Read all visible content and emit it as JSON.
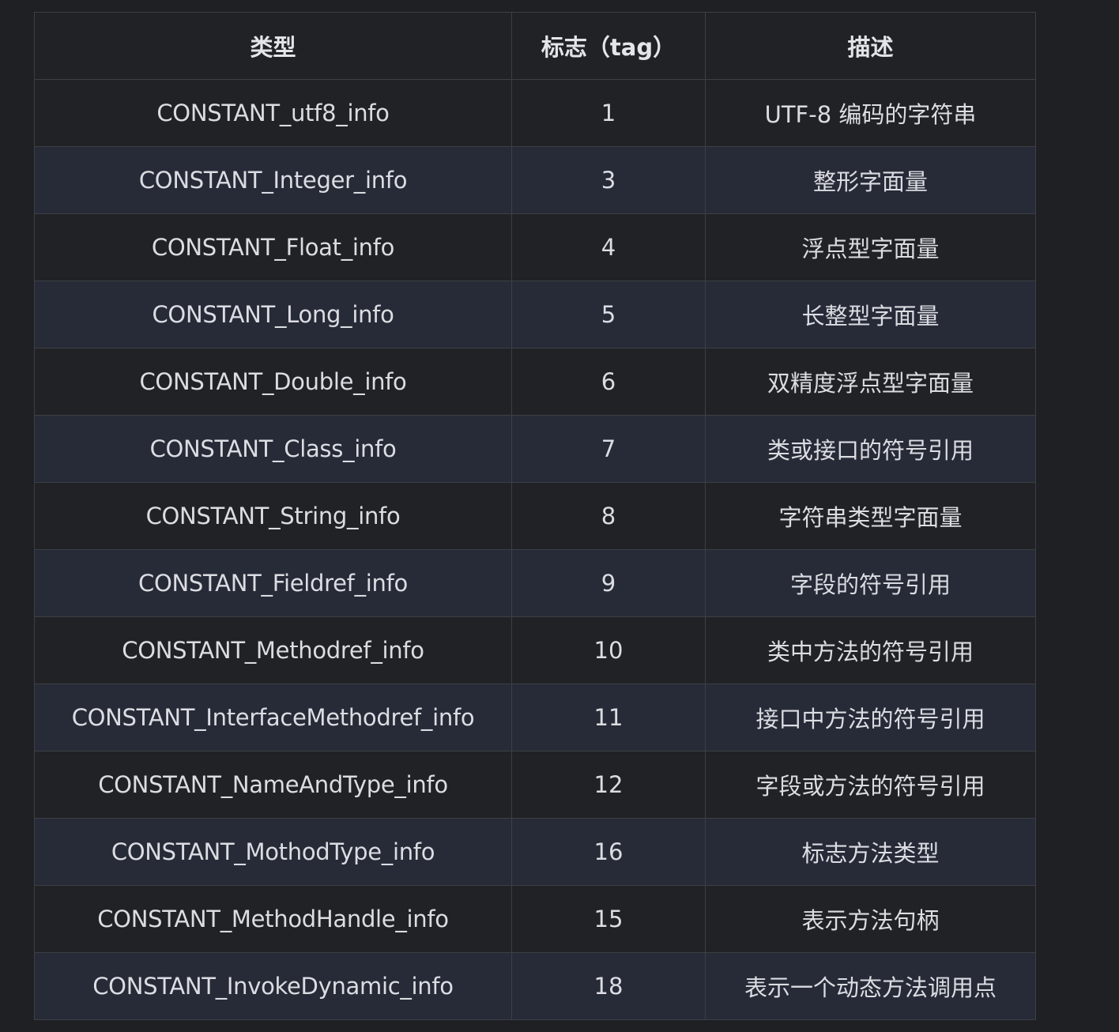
{
  "table": {
    "headers": [
      "类型",
      "标志（tag）",
      "描述"
    ],
    "rows": [
      {
        "type": "CONSTANT_utf8_info",
        "tag": "1",
        "desc": "UTF-8 编码的字符串"
      },
      {
        "type": "CONSTANT_Integer_info",
        "tag": "3",
        "desc": "整形字面量"
      },
      {
        "type": "CONSTANT_Float_info",
        "tag": "4",
        "desc": "浮点型字面量"
      },
      {
        "type": "CONSTANT_Long_info",
        "tag": "5",
        "desc": "长整型字面量"
      },
      {
        "type": "CONSTANT_Double_info",
        "tag": "6",
        "desc": "双精度浮点型字面量"
      },
      {
        "type": "CONSTANT_Class_info",
        "tag": "7",
        "desc": "类或接口的符号引用"
      },
      {
        "type": "CONSTANT_String_info",
        "tag": "8",
        "desc": "字符串类型字面量"
      },
      {
        "type": "CONSTANT_Fieldref_info",
        "tag": "9",
        "desc": "字段的符号引用"
      },
      {
        "type": "CONSTANT_Methodref_info",
        "tag": "10",
        "desc": "类中方法的符号引用"
      },
      {
        "type": "CONSTANT_InterfaceMethodref_info",
        "tag": "11",
        "desc": "接口中方法的符号引用"
      },
      {
        "type": "CONSTANT_NameAndType_info",
        "tag": "12",
        "desc": "字段或方法的符号引用"
      },
      {
        "type": "CONSTANT_MothodType_info",
        "tag": "16",
        "desc": "标志方法类型"
      },
      {
        "type": "CONSTANT_MethodHandle_info",
        "tag": "15",
        "desc": "表示方法句柄"
      },
      {
        "type": "CONSTANT_InvokeDynamic_info",
        "tag": "18",
        "desc": "表示一个动态方法调用点"
      }
    ]
  },
  "colors": {
    "background": "#1f2024",
    "row_dark": "#212226",
    "row_alt": "#272b38",
    "border": "#3d3f45",
    "text": "#dcdde2"
  }
}
